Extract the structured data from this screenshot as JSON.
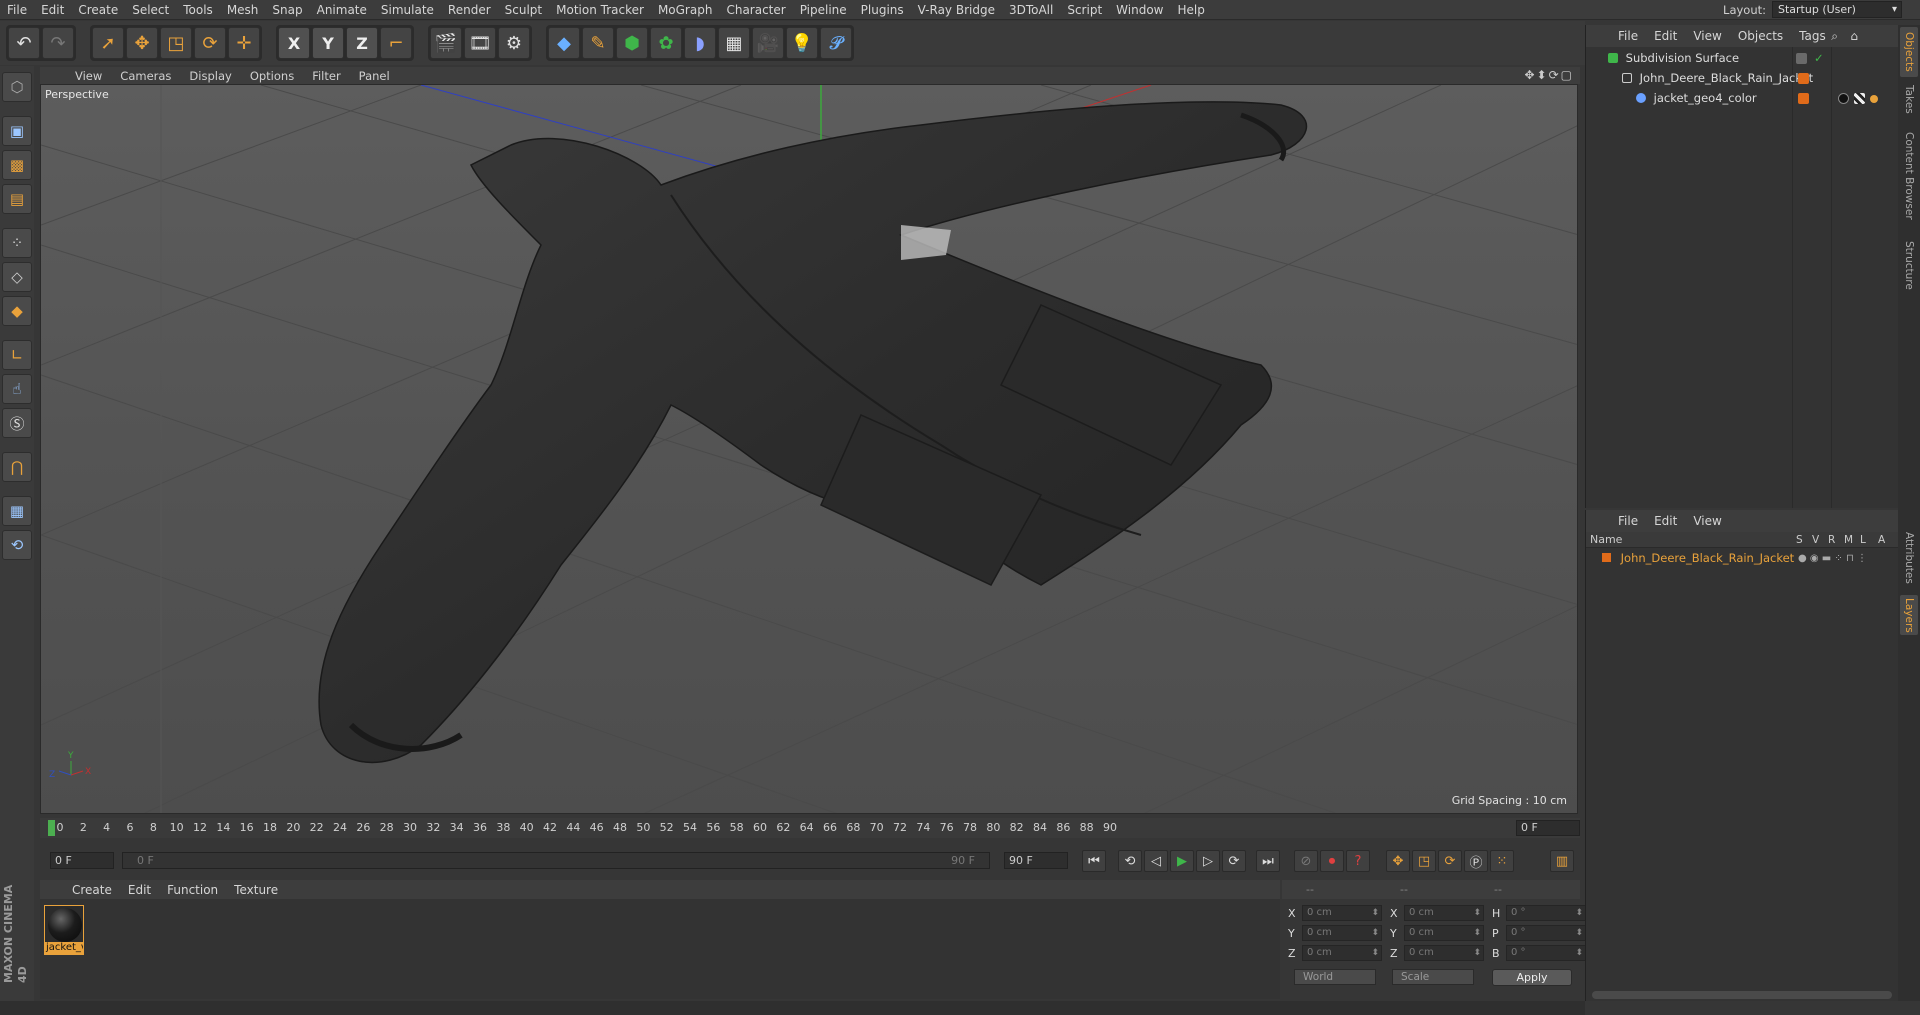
{
  "menubar": {
    "items": [
      "File",
      "Edit",
      "Create",
      "Select",
      "Tools",
      "Mesh",
      "Snap",
      "Animate",
      "Simulate",
      "Render",
      "Sculpt",
      "Motion Tracker",
      "MoGraph",
      "Character",
      "Pipeline",
      "Plugins",
      "V-Ray Bridge",
      "3DToAll",
      "Script",
      "Window",
      "Help"
    ],
    "layout_label": "Layout:",
    "layout_value": "Startup (User)"
  },
  "toolbar": {
    "axis_x": "X",
    "axis_y": "Y",
    "axis_z": "Z",
    "icons": [
      "undo-icon",
      "redo-icon",
      "select-icon",
      "move-icon",
      "scale-icon",
      "rotate-icon",
      "live-move-icon",
      "axis-x",
      "axis-y",
      "axis-z",
      "coord-system-icon",
      "render-view-icon",
      "render-picture-viewer-icon",
      "render-settings-icon",
      "cube-icon",
      "pen-icon",
      "subdivision-icon",
      "cloner-icon",
      "deformer-icon",
      "floor-icon",
      "camera-icon",
      "light-icon",
      "python-icon"
    ]
  },
  "viewport": {
    "menu": [
      "View",
      "Cameras",
      "Display",
      "Options",
      "Filter",
      "Panel"
    ],
    "label": "Perspective",
    "grid_spacing": "Grid Spacing : 10 cm"
  },
  "timeline": {
    "ticks": [
      "0",
      "2",
      "4",
      "6",
      "8",
      "10",
      "12",
      "14",
      "16",
      "18",
      "20",
      "22",
      "24",
      "26",
      "28",
      "30",
      "32",
      "34",
      "36",
      "38",
      "40",
      "42",
      "44",
      "46",
      "48",
      "50",
      "52",
      "54",
      "56",
      "58",
      "60",
      "62",
      "64",
      "66",
      "68",
      "70",
      "72",
      "74",
      "76",
      "78",
      "80",
      "82",
      "84",
      "86",
      "88",
      "90"
    ],
    "current_frame": "0 F"
  },
  "transport": {
    "start_field": "0 F",
    "range_start": "0 F",
    "range_end": "90 F",
    "end_field": "90 F"
  },
  "material_manager": {
    "menu": [
      "Create",
      "Edit",
      "Function",
      "Texture"
    ],
    "material_name": "jacket_v"
  },
  "coordinates": {
    "header_left": "--",
    "header_mid": "--",
    "header_right": "--",
    "x_pos": "0 cm",
    "y_pos": "0 cm",
    "z_pos": "0 cm",
    "x_size": "0 cm",
    "y_size": "0 cm",
    "z_size": "0 cm",
    "h_rot": "0 °",
    "p_rot": "0 °",
    "b_rot": "0 °",
    "space_dropdown": "World",
    "mode_dropdown": "Scale",
    "apply_label": "Apply"
  },
  "object_manager": {
    "menu": [
      "File",
      "Edit",
      "View",
      "Objects",
      "Tags"
    ],
    "objects": [
      {
        "name": "Subdivision Surface",
        "color": "#3fb64a"
      },
      {
        "name": "John_Deere_Black_Rain_Jacket",
        "color": "#9aa"
      },
      {
        "name": "jacket_geo4_color",
        "color": "#6aa0ff"
      }
    ]
  },
  "layer_manager": {
    "menu": [
      "File",
      "Edit",
      "View"
    ],
    "header_name": "Name",
    "columns": [
      "S",
      "V",
      "R",
      "M",
      "L",
      "A"
    ],
    "layer_name": "John_Deere_Black_Rain_Jacket"
  },
  "side_tabs": [
    "Objects",
    "Takes",
    "Content Browser",
    "Structure",
    "Attributes",
    "Layers"
  ],
  "colors": {
    "accent": "#e9a23b",
    "background": "#363636",
    "layer_swatch": "#e06b1a"
  }
}
